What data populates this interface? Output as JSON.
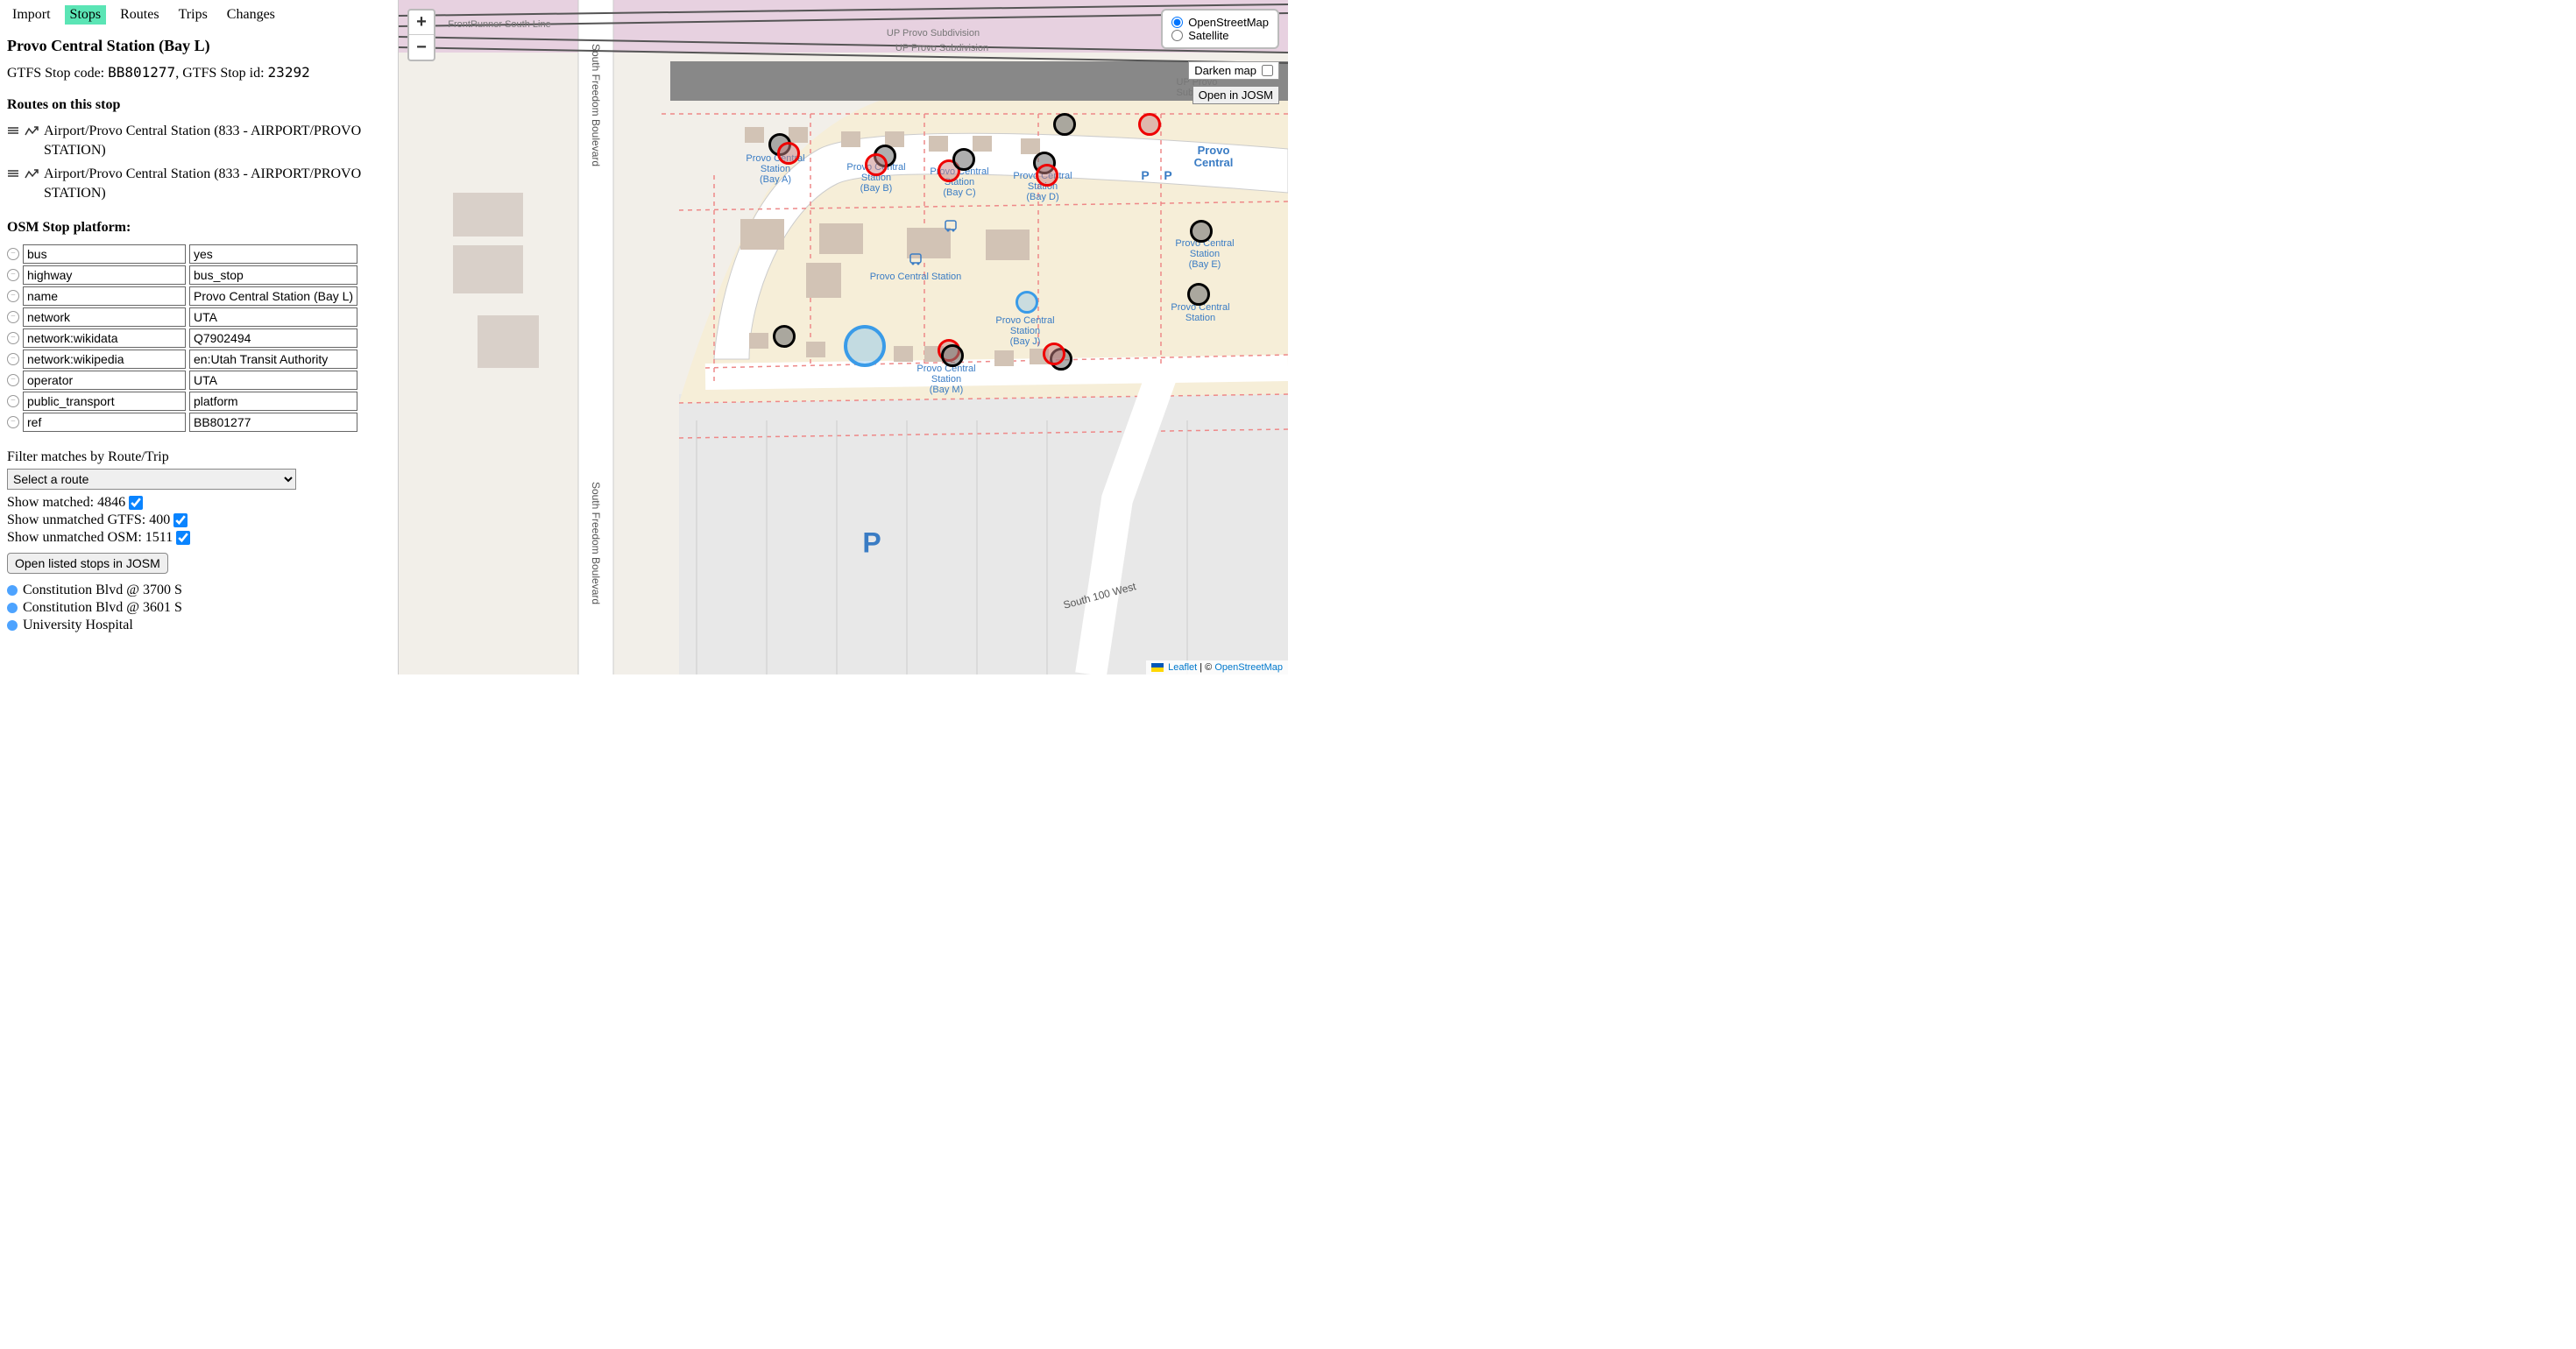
{
  "nav": {
    "import": "Import",
    "stops": "Stops",
    "routes": "Routes",
    "trips": "Trips",
    "changes": "Changes",
    "active": "Stops"
  },
  "stop": {
    "title": "Provo Central Station (Bay L)",
    "code_label": "GTFS Stop code:",
    "code": "BB801277",
    "id_label": "GTFS Stop id:",
    "id": "23292"
  },
  "routes_heading": "Routes on this stop",
  "routes": [
    "Airport/Provo Central Station (833 - AIRPORT/PROVO STATION)",
    "Airport/Provo Central Station (833 - AIRPORT/PROVO STATION)"
  ],
  "platform_heading": "OSM Stop platform:",
  "tags": [
    {
      "k": "bus",
      "v": "yes"
    },
    {
      "k": "highway",
      "v": "bus_stop"
    },
    {
      "k": "name",
      "v": "Provo Central Station (Bay L)"
    },
    {
      "k": "network",
      "v": "UTA"
    },
    {
      "k": "network:wikidata",
      "v": "Q7902494"
    },
    {
      "k": "network:wikipedia",
      "v": "en:Utah Transit Authority"
    },
    {
      "k": "operator",
      "v": "UTA"
    },
    {
      "k": "public_transport",
      "v": "platform"
    },
    {
      "k": "ref",
      "v": "BB801277"
    }
  ],
  "filter": {
    "heading": "Filter matches by Route/Trip",
    "select_placeholder": "Select a route",
    "matched_label": "Show matched:",
    "matched_count": "4846",
    "unmatched_gtfs_label": "Show unmatched GTFS:",
    "unmatched_gtfs_count": "400",
    "unmatched_osm_label": "Show unmatched OSM:",
    "unmatched_osm_count": "1511",
    "josm_button": "Open listed stops in JOSM"
  },
  "stops_list": [
    "Constitution Blvd @ 3700 S",
    "Constitution Blvd @ 3601 S",
    "University Hospital"
  ],
  "map": {
    "layers": {
      "osm": "OpenStreetMap",
      "sat": "Satellite"
    },
    "darken": "Darken map",
    "open_josm": "Open in JOSM",
    "attribution_leaflet": "Leaflet",
    "attribution_osm": "OpenStreetMap",
    "sep": " | © ",
    "roads": {
      "freedom_top": "South Freedom Boulevard",
      "freedom_bot": "South Freedom Boulevard",
      "s100w": "South 100 West"
    },
    "rail": {
      "front": "FrontRunner South Line",
      "up1": "UP Provo Subdivision",
      "up2": "UP Provo Subdivision",
      "up3": "UP Provo Subdivision"
    },
    "stop_labels": {
      "bay_a": "Provo Central\nStation\n(Bay A)",
      "bay_b": "Provo Central\nStation\n(Bay B)",
      "bay_c": "Provo Central\nStation\n(Bay C)",
      "bay_d": "Provo Central\nStation\n(Bay D)",
      "bay_e": "Provo Central\nStation\n(Bay E)",
      "bay_j": "Provo Central\nStation\n(Bay J)",
      "bay_m": "Provo Central\nStation\n(Bay M)",
      "central": "Provo Central Station",
      "station": "Provo Central\nStation",
      "provo_central": "Provo\nCentral"
    },
    "big_p": "P"
  }
}
